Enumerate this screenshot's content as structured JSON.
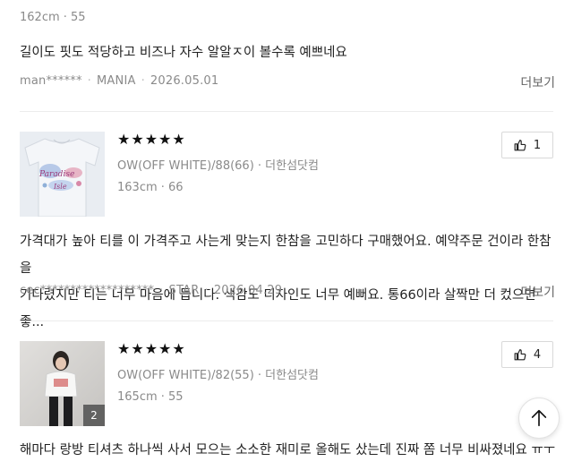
{
  "review_prev": {
    "body_size": "162cm · 55",
    "text": "길이도 핏도 적당하고 비즈나 자수 알알ㅈ이 볼수록 예쁘네요",
    "user": "man******",
    "grade": "MANIA",
    "date": "2026.05.01",
    "more_label": "더보기"
  },
  "reviews": [
    {
      "rating_stars": "★★★★★",
      "option": "OW(OFF WHITE)/88(66) · 더한섬닷컴",
      "body_size": "163cm · 66",
      "likes": "1",
      "text_line1": "가격대가 높아 티를 이 가격주고 사는게 맞는지 한참을 고민하다 구매했어요. 예약주문 건이라 한참을",
      "text_line2": "기다렸지만 티는 너무 마음에 듭니다. 색감도 디자인도 너무 예뻐요. 통66이라 살짝만 더 컸으면 좋...",
      "user": "cec*******************",
      "grade": "STAR",
      "date": "2026.04.29",
      "more_label": "더보기"
    },
    {
      "rating_stars": "★★★★★",
      "option": "OW(OFF WHITE)/82(55) · 더한섬닷컴",
      "body_size": "165cm · 55",
      "likes": "4",
      "photo_count": "2",
      "text_line1": "해마다 랑방 티셔츠 하나씩 사서 모으는 소소한 재미로 올해도 샀는데 진짜 쫌 너무 비싸졌네요 ㅠㅜ"
    }
  ],
  "icons": {
    "like": "thumbs-up-icon",
    "scroll_top": "arrow-up-icon"
  },
  "colors": {
    "text": "#222222",
    "muted": "#8a8a8a",
    "divider": "#ececec"
  }
}
